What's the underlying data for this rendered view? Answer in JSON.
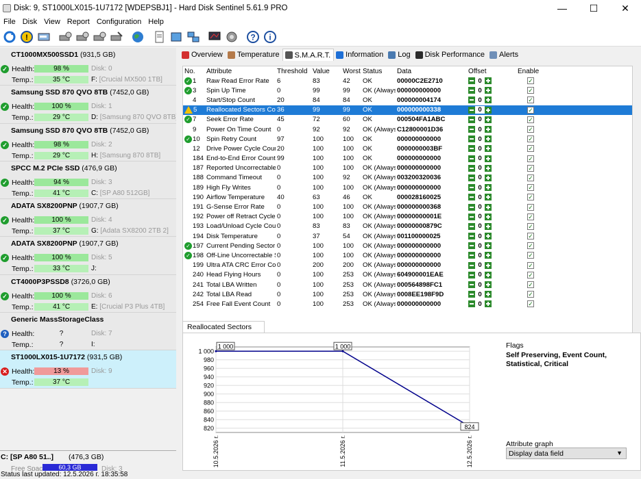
{
  "window": {
    "title": "Disk: 9, ST1000LX015-1U7172 [WDEPSBJ1]  -  Hard Disk Sentinel 5.61.9 PRO",
    "minimize": "—",
    "maximize": "☐",
    "close": "✕"
  },
  "menu": [
    "File",
    "Disk",
    "View",
    "Report",
    "Configuration",
    "Help"
  ],
  "toolbar_icons": [
    "refresh-icon",
    "alert-icon",
    "disk-info-icon",
    "settings-icon",
    "test-icon",
    "surface-test-icon",
    "erase-icon",
    "globe-icon",
    "report-icon",
    "send-report-icon",
    "network-icon",
    "monitor-icon",
    "options-icon",
    "help-icon",
    "about-icon"
  ],
  "labels": {
    "health": "Health:",
    "temp": "Temp.:"
  },
  "disks": [
    {
      "name": "CT1000MX500SSD1",
      "capacity": "(931,5 GB)",
      "health": "98 %",
      "temp": "35 °C",
      "disk_no": "Disk: 0",
      "drive": "F:",
      "volume": "[Crucial MX500 1TB]",
      "status": "ok"
    },
    {
      "name": "Samsung SSD 870 QVO 8TB",
      "capacity": "(7452,0 GB)",
      "health": "100 %",
      "temp": "29 °C",
      "disk_no": "Disk: 1",
      "drive": "D:",
      "volume": "[Samsung 870 QVO 8TB]",
      "status": "ok"
    },
    {
      "name": "Samsung SSD 870 QVO 8TB",
      "capacity": "(7452,0 GB)",
      "health": "98 %",
      "temp": "29 °C",
      "disk_no": "Disk: 2",
      "drive": "H:",
      "volume": "[Samsung 870 8TB]",
      "status": "ok"
    },
    {
      "name": "SPCC M.2 PCIe SSD",
      "capacity": "(476,9 GB)",
      "health": "94 %",
      "temp": "41 °C",
      "disk_no": "Disk: 3",
      "drive": "C:",
      "volume": "[SP A80 512GB]",
      "status": "ok"
    },
    {
      "name": "ADATA SX8200PNP",
      "capacity": "(1907,7 GB)",
      "health": "100 %",
      "temp": "37 °C",
      "disk_no": "Disk: 4",
      "drive": "G:",
      "volume": "[Adata SX8200 2TB 2]",
      "status": "ok"
    },
    {
      "name": "ADATA SX8200PNP",
      "capacity": "(1907,7 GB)",
      "health": "100 %",
      "temp": "33 °C",
      "disk_no": "Disk: 5",
      "drive": "J:",
      "volume": "",
      "status": "ok"
    },
    {
      "name": "CT4000P3PSSD8",
      "capacity": "(3726,0 GB)",
      "health": "100 %",
      "temp": "41 °C",
      "disk_no": "Disk: 6",
      "drive": "E:",
      "volume": "[Crucial P3 Plus 4TB]",
      "status": "ok"
    },
    {
      "name": "Generic MassStorageClass",
      "capacity": "",
      "health": "?",
      "temp": "?",
      "disk_no": "Disk: 7",
      "drive": "I:",
      "volume": "",
      "status": "unknown"
    },
    {
      "name": "ST1000LX015-1U7172",
      "capacity": "(931,5 GB)",
      "health": "13 %",
      "temp": "37 °C",
      "disk_no": "Disk: 9",
      "drive": "",
      "volume": "",
      "status": "bad"
    }
  ],
  "partition": {
    "title": "C: [SP A80 51..]",
    "capacity": "(476,3 GB)",
    "free_label": "Free Space",
    "free_value": "60,3 GB",
    "disk_label": "Disk: 3"
  },
  "status_bar": "Status last updated: 12.5.2026 г. 18:35:58",
  "tabs": [
    {
      "label": "Overview",
      "active": false,
      "color": "#d32f2f"
    },
    {
      "label": "Temperature",
      "active": false,
      "color": "#b47a4a"
    },
    {
      "label": "S.M.A.R.T.",
      "active": true,
      "color": "#555555"
    },
    {
      "label": "Information",
      "active": false,
      "color": "#1e6fd6"
    },
    {
      "label": "Log",
      "active": false,
      "color": "#4a7ab0"
    },
    {
      "label": "Disk Performance",
      "active": false,
      "color": "#2b2b2b"
    },
    {
      "label": "Alerts",
      "active": false,
      "color": "#6f8fb8"
    }
  ],
  "smart_headers": {
    "no": "No.",
    "attribute": "Attribute",
    "threshold": "Threshold",
    "value": "Value",
    "worst": "Worst",
    "status": "Status",
    "data": "Data",
    "offset": "Offset",
    "enable": "Enable"
  },
  "smart_rows": [
    {
      "icon": "ok",
      "no": "1",
      "attribute": "Raw Read Error Rate",
      "threshold": "6",
      "value": "83",
      "worst": "42",
      "status": "OK",
      "data": "00000C2E2710",
      "offset": "0"
    },
    {
      "icon": "ok",
      "no": "3",
      "attribute": "Spin Up Time",
      "threshold": "0",
      "value": "99",
      "worst": "99",
      "status": "OK (Always ...",
      "data": "000000000000",
      "offset": "0"
    },
    {
      "icon": "",
      "no": "4",
      "attribute": "Start/Stop Count",
      "threshold": "20",
      "value": "84",
      "worst": "84",
      "status": "OK",
      "data": "000000004174",
      "offset": "0"
    },
    {
      "icon": "warn",
      "no": "5",
      "attribute": "Reallocated Sectors Count",
      "threshold": "36",
      "value": "99",
      "worst": "99",
      "status": "OK",
      "data": "000000000338",
      "offset": "0",
      "selected": true
    },
    {
      "icon": "ok",
      "no": "7",
      "attribute": "Seek Error Rate",
      "threshold": "45",
      "value": "72",
      "worst": "60",
      "status": "OK",
      "data": "000504FA1ABC",
      "offset": "0"
    },
    {
      "icon": "",
      "no": "9",
      "attribute": "Power On Time Count",
      "threshold": "0",
      "value": "92",
      "worst": "92",
      "status": "OK (Always ...",
      "data": "C12800001D36",
      "offset": "0"
    },
    {
      "icon": "ok",
      "no": "10",
      "attribute": "Spin Retry Count",
      "threshold": "97",
      "value": "100",
      "worst": "100",
      "status": "OK",
      "data": "000000000000",
      "offset": "0"
    },
    {
      "icon": "",
      "no": "12",
      "attribute": "Drive Power Cycle Count",
      "threshold": "20",
      "value": "100",
      "worst": "100",
      "status": "OK",
      "data": "0000000003BF",
      "offset": "0"
    },
    {
      "icon": "",
      "no": "184",
      "attribute": "End-to-End Error Count",
      "threshold": "99",
      "value": "100",
      "worst": "100",
      "status": "OK",
      "data": "000000000000",
      "offset": "0"
    },
    {
      "icon": "",
      "no": "187",
      "attribute": "Reported Uncorrectable Er...",
      "threshold": "0",
      "value": "100",
      "worst": "100",
      "status": "OK (Always ...",
      "data": "000000000000",
      "offset": "0"
    },
    {
      "icon": "",
      "no": "188",
      "attribute": "Command Timeout",
      "threshold": "0",
      "value": "100",
      "worst": "92",
      "status": "OK (Always ...",
      "data": "003200320036",
      "offset": "0"
    },
    {
      "icon": "",
      "no": "189",
      "attribute": "High Fly Writes",
      "threshold": "0",
      "value": "100",
      "worst": "100",
      "status": "OK (Always ...",
      "data": "000000000000",
      "offset": "0"
    },
    {
      "icon": "",
      "no": "190",
      "attribute": "Airflow Temperature",
      "threshold": "40",
      "value": "63",
      "worst": "46",
      "status": "OK",
      "data": "000028160025",
      "offset": "0"
    },
    {
      "icon": "",
      "no": "191",
      "attribute": "G-Sense Error Rate",
      "threshold": "0",
      "value": "100",
      "worst": "100",
      "status": "OK (Always ...",
      "data": "000000000368",
      "offset": "0"
    },
    {
      "icon": "",
      "no": "192",
      "attribute": "Power off Retract Cycle Co...",
      "threshold": "0",
      "value": "100",
      "worst": "100",
      "status": "OK (Always ...",
      "data": "00000000001E",
      "offset": "0"
    },
    {
      "icon": "",
      "no": "193",
      "attribute": "Load/Unload Cycle Count",
      "threshold": "0",
      "value": "83",
      "worst": "83",
      "status": "OK (Always ...",
      "data": "00000000879C",
      "offset": "0"
    },
    {
      "icon": "",
      "no": "194",
      "attribute": "Disk Temperature",
      "threshold": "0",
      "value": "37",
      "worst": "54",
      "status": "OK (Always ...",
      "data": "001100000025",
      "offset": "0"
    },
    {
      "icon": "ok",
      "no": "197",
      "attribute": "Current Pending Sector Co...",
      "threshold": "0",
      "value": "100",
      "worst": "100",
      "status": "OK (Always ...",
      "data": "000000000000",
      "offset": "0"
    },
    {
      "icon": "ok",
      "no": "198",
      "attribute": "Off-Line Uncorrectable Sec...",
      "threshold": "0",
      "value": "100",
      "worst": "100",
      "status": "OK (Always ...",
      "data": "000000000000",
      "offset": "0"
    },
    {
      "icon": "",
      "no": "199",
      "attribute": "Ultra ATA CRC Error Count",
      "threshold": "0",
      "value": "200",
      "worst": "200",
      "status": "OK (Always ...",
      "data": "000000000000",
      "offset": "0"
    },
    {
      "icon": "",
      "no": "240",
      "attribute": "Head Flying Hours",
      "threshold": "0",
      "value": "100",
      "worst": "253",
      "status": "OK (Always ...",
      "data": "604900001EAE",
      "offset": "0"
    },
    {
      "icon": "",
      "no": "241",
      "attribute": "Total LBA Written",
      "threshold": "0",
      "value": "100",
      "worst": "253",
      "status": "OK (Always ...",
      "data": "000564898FC1",
      "offset": "0"
    },
    {
      "icon": "",
      "no": "242",
      "attribute": "Total LBA Read",
      "threshold": "0",
      "value": "100",
      "worst": "253",
      "status": "OK (Always ...",
      "data": "0008EE198F9D",
      "offset": "0"
    },
    {
      "icon": "",
      "no": "254",
      "attribute": "Free Fall Event Count",
      "threshold": "0",
      "value": "100",
      "worst": "253",
      "status": "OK (Always ...",
      "data": "000000000000",
      "offset": "0"
    }
  ],
  "graph_tab": "Reallocated Sectors Count",
  "flags": {
    "label": "Flags",
    "value": "Self Preserving, Event Count, Statistical, Critical"
  },
  "attribute_graph": {
    "label": "Attribute graph",
    "selected": "Display data field"
  },
  "chart_data": {
    "type": "line",
    "x": [
      "10.5.2026 г.",
      "11.5.2026 г.",
      "12.5.2026 г."
    ],
    "values": [
      1000,
      1000,
      824
    ],
    "point_labels": [
      "1 000",
      "1 000",
      "824"
    ],
    "ylim": [
      810,
      1010
    ],
    "yticks": [
      1000,
      980,
      960,
      940,
      920,
      900,
      880,
      860,
      840,
      820
    ],
    "ytick_labels": [
      "1 000",
      "980",
      "960",
      "940",
      "920",
      "900",
      "880",
      "860",
      "840",
      "820"
    ],
    "grid": true,
    "line_color": "#00008b"
  }
}
